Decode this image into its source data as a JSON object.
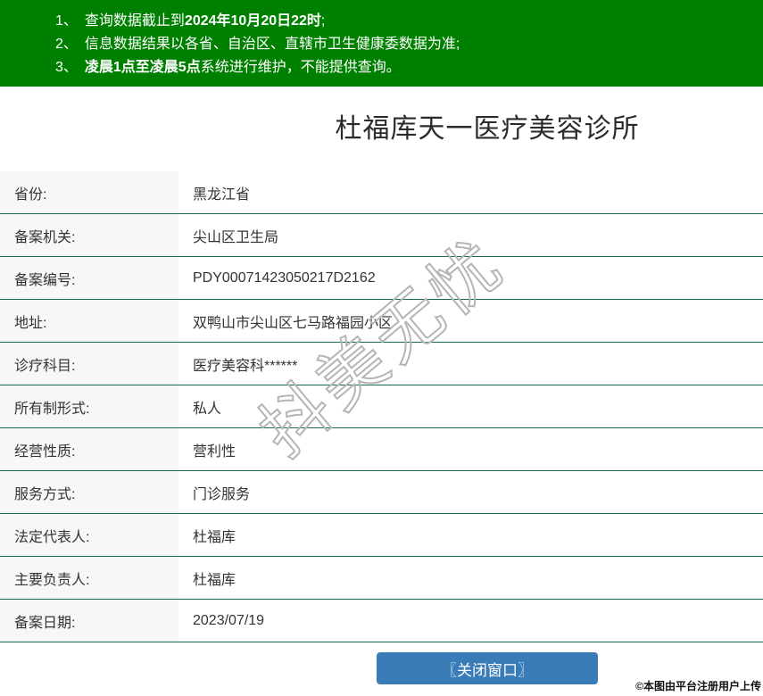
{
  "header": {
    "notices": [
      {
        "num": "1、",
        "pre": "查询数据截止到",
        "bold": "2024年10月20日22时",
        "post": ";"
      },
      {
        "num": "2、",
        "pre": "信息数据结果以各省、自治区、直辖市卫生健康委数据为准;",
        "bold": "",
        "post": ""
      },
      {
        "num": "3、",
        "pre": "",
        "bold": "凌晨1点至凌晨5点",
        "post": "系统进行维护，不能提供查询。"
      }
    ]
  },
  "title": "杜福库天一医疗美容诊所",
  "table": {
    "fields": [
      {
        "label": "省份:",
        "value": "黑龙江省"
      },
      {
        "label": "备案机关:",
        "value": "尖山区卫生局"
      },
      {
        "label": "备案编号:",
        "value": "PDY00071423050217D2162"
      },
      {
        "label": "地址:",
        "value": "双鸭山市尖山区七马路福园小区"
      },
      {
        "label": "诊疗科目:",
        "value": "医疗美容科******"
      },
      {
        "label": "所有制形式:",
        "value": "私人"
      },
      {
        "label": "经营性质:",
        "value": "营利性"
      },
      {
        "label": "服务方式:",
        "value": "门诊服务"
      },
      {
        "label": "法定代表人:",
        "value": "杜福库"
      },
      {
        "label": "主要负责人:",
        "value": "杜福库"
      },
      {
        "label": "备案日期:",
        "value": "2023/07/19"
      }
    ]
  },
  "button": {
    "close_label": "〖关闭窗口〗"
  },
  "watermark": "抖美无忧",
  "credit": "©本图由平台注册用户上传",
  "colors": {
    "header_green": "#008000",
    "divider_green": "#1a6b42",
    "label_bg": "#f7f7f7",
    "button_blue": "#3a7cb8"
  }
}
